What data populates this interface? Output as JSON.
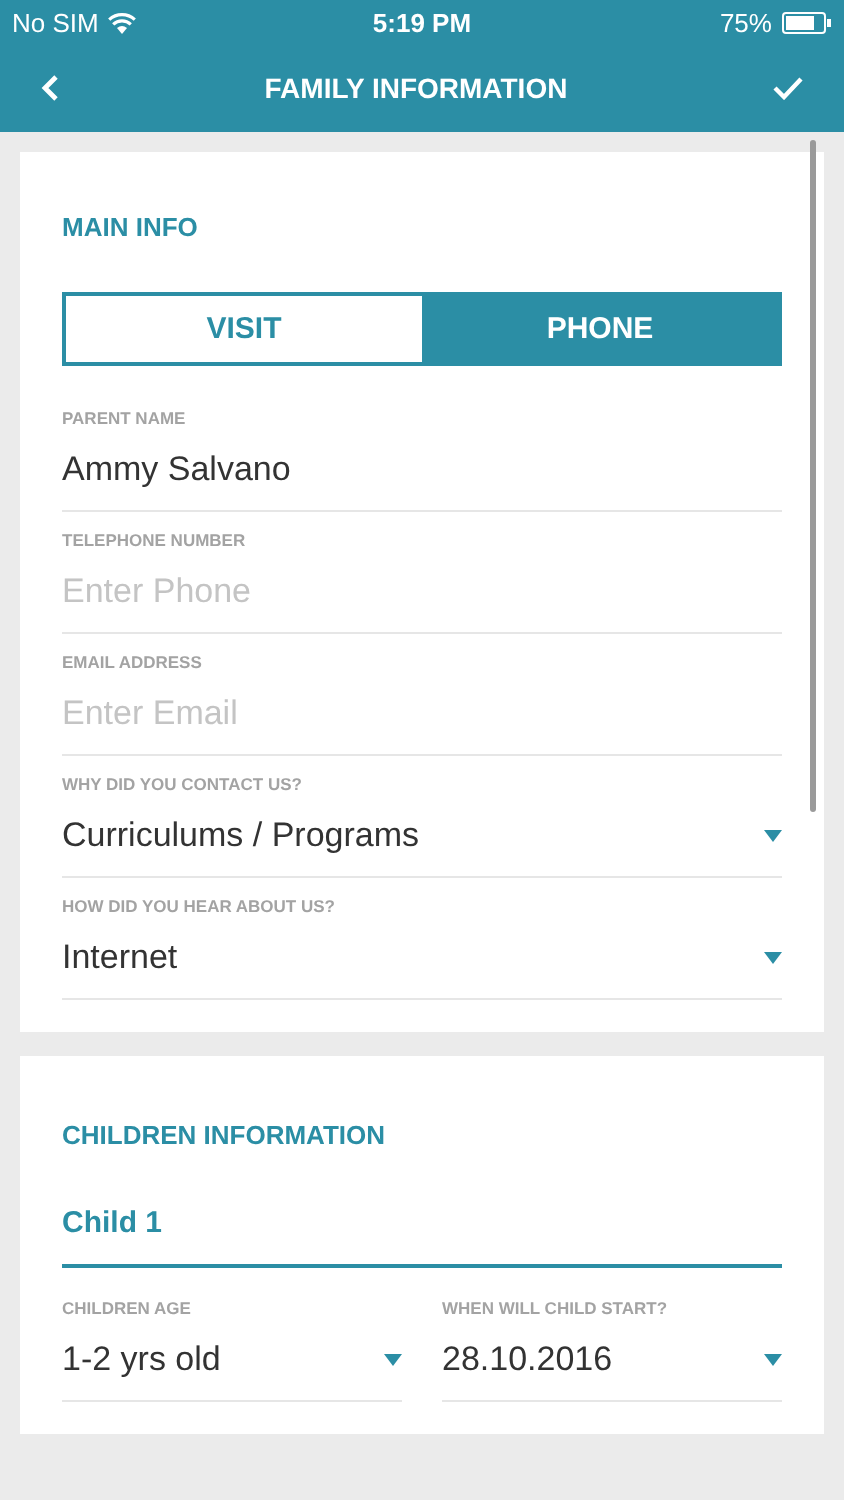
{
  "status_bar": {
    "carrier": "No SIM",
    "time": "5:19 PM",
    "battery": "75%"
  },
  "nav_bar": {
    "title": "FAMILY INFORMATION"
  },
  "main_info": {
    "title": "MAIN INFO",
    "tabs": [
      {
        "label": "VISIT",
        "selected": false
      },
      {
        "label": "PHONE",
        "selected": true
      }
    ],
    "fields": [
      {
        "kind": "text",
        "label": "PARENT NAME",
        "value": "Ammy Salvano"
      },
      {
        "kind": "text",
        "label": "TELEPHONE NUMBER",
        "placeholder": "Enter Phone"
      },
      {
        "kind": "text",
        "label": "EMAIL ADDRESS",
        "placeholder": "Enter Email"
      },
      {
        "kind": "dropdown",
        "label": "WHY DID YOU CONTACT US?",
        "value": "Curriculums / Programs"
      },
      {
        "kind": "dropdown",
        "label": "HOW DID YOU HEAR ABOUT US?",
        "value": "Internet"
      }
    ]
  },
  "children_info": {
    "title": "CHILDREN INFORMATION",
    "child_title": "Child 1",
    "fields": [
      {
        "kind": "dropdown",
        "label": "CHILDREN AGE",
        "value": "1-2 yrs old"
      },
      {
        "kind": "dropdown",
        "label": "WHEN WILL CHILD START?",
        "value": "28.10.2016"
      }
    ]
  }
}
